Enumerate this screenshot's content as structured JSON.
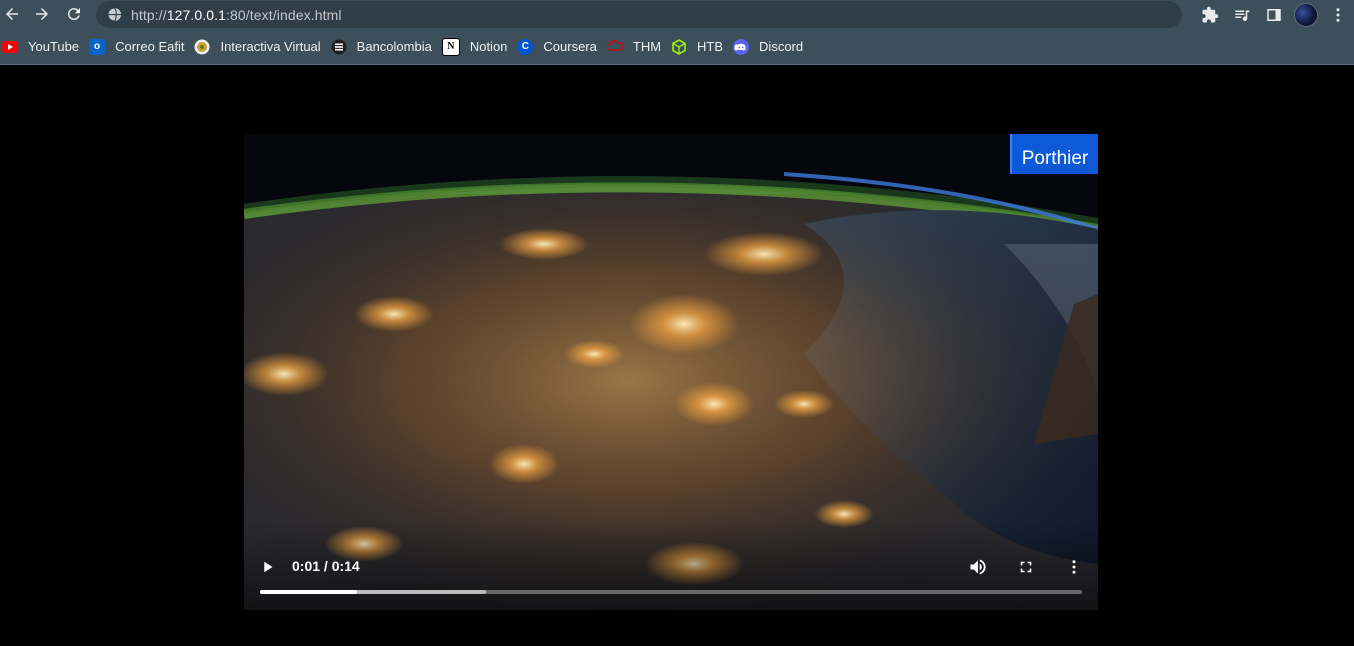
{
  "browser": {
    "url_prefix": "http://",
    "url_host": "127.0.0.1",
    "url_rest": ":80/text/index.html"
  },
  "bookmarks": [
    {
      "label": "YouTube",
      "icon": "youtube-icon",
      "color": "#ff0000"
    },
    {
      "label": "Correo Eafit",
      "icon": "outlook-icon",
      "color": "#0a64c8"
    },
    {
      "label": "Interactiva Virtual",
      "icon": "interactiva-icon",
      "color": "#c9a227"
    },
    {
      "label": "Bancolombia",
      "icon": "bancolombia-icon",
      "color": "#1f1f1f"
    },
    {
      "label": "Notion",
      "icon": "notion-icon",
      "color": "#ffffff"
    },
    {
      "label": "Coursera",
      "icon": "coursera-icon",
      "color": "#0056d2"
    },
    {
      "label": "THM",
      "icon": "thm-icon",
      "color": "#c11111"
    },
    {
      "label": "HTB",
      "icon": "htb-icon",
      "color": "#9fef00"
    },
    {
      "label": "Discord",
      "icon": "discord-icon",
      "color": "#5865f2"
    }
  ],
  "video": {
    "watermark": "Porthier",
    "time_display": "0:01 / 0:14",
    "played_fraction": 0.118,
    "buffered_fraction": 0.275
  }
}
